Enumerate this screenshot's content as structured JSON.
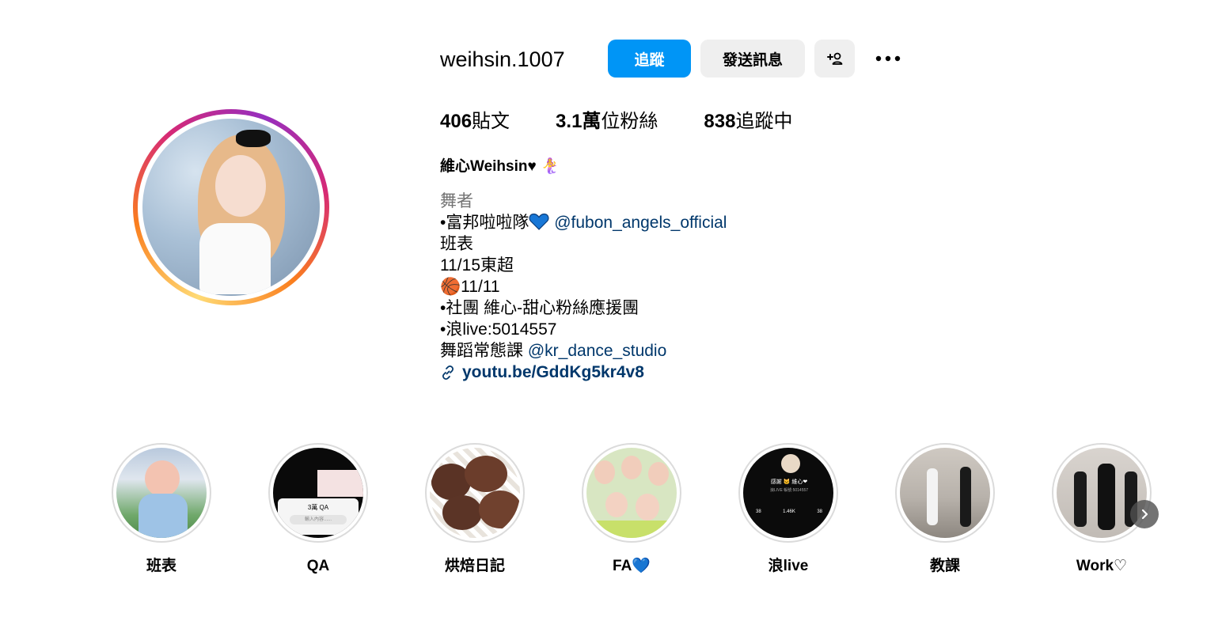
{
  "profile": {
    "username": "weihsin.1007",
    "follow_label": "追蹤",
    "message_label": "發送訊息",
    "display_name": "維心Weihsin♥",
    "display_name_emoji": "🧜‍♀️"
  },
  "stats": {
    "posts_count": "406",
    "posts_label": "貼文",
    "followers_count": "3.1萬",
    "followers_label": "位粉絲",
    "following_count": "838",
    "following_label": "追蹤中"
  },
  "bio": {
    "category": "舞者",
    "line1_prefix": "•富邦啦啦隊",
    "line1_mention": "@fubon_angels_official",
    "line2": "班表",
    "line3": "11/15東超",
    "line4": "🏀11/11",
    "line5": "•社團 維心-甜心粉絲應援團",
    "line6": "•浪live:5014557",
    "line7_prefix": "舞蹈常態課 ",
    "line7_mention": "@kr_dance_studio",
    "link": "youtu.be/GddKg5kr4v8"
  },
  "highlights": [
    {
      "label": "班表"
    },
    {
      "label": "QA"
    },
    {
      "label": "烘焙日記"
    },
    {
      "label": "FA💙"
    },
    {
      "label": "浪live"
    },
    {
      "label": "教課"
    },
    {
      "label": "Work♡"
    }
  ],
  "highlight_thumbs": {
    "qa_title": "3萬 QA",
    "qa_input": "輸入內容......",
    "live_name": "感謝 🐱 維心❤",
    "live_id": "浪LIVE 帳號:5014557",
    "live_stats": [
      "38",
      "1.46K",
      "38"
    ]
  },
  "colors": {
    "accent": "#0095f6",
    "mention": "#00376b",
    "secondary_button": "#efefef"
  },
  "icons": {
    "add_user": "add-user-icon",
    "more": "more-icon",
    "link": "link-icon",
    "next": "chevron-right-icon"
  }
}
